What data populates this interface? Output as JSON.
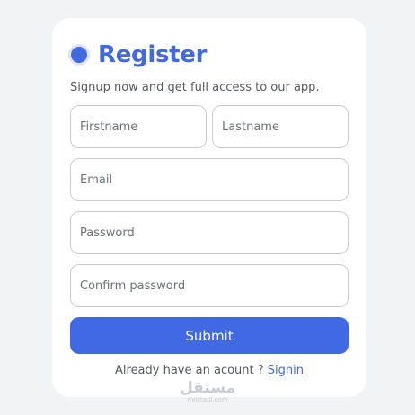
{
  "form": {
    "title": "Register",
    "subtitle": "Signup now and get full access to our app.",
    "fields": {
      "firstname_placeholder": "Firstname",
      "lastname_placeholder": "Lastname",
      "email_placeholder": "Email",
      "password_placeholder": "Password",
      "confirm_password_placeholder": "Confirm password"
    },
    "submit_label": "Submit",
    "footer_text": "Already have an acount ? ",
    "signin_link": "Signin"
  },
  "watermark": {
    "arabic": "مستقل",
    "latin": "mostaql.com"
  },
  "colors": {
    "accent": "#4169e1",
    "background": "#f2f3f5",
    "card": "#ffffff"
  }
}
